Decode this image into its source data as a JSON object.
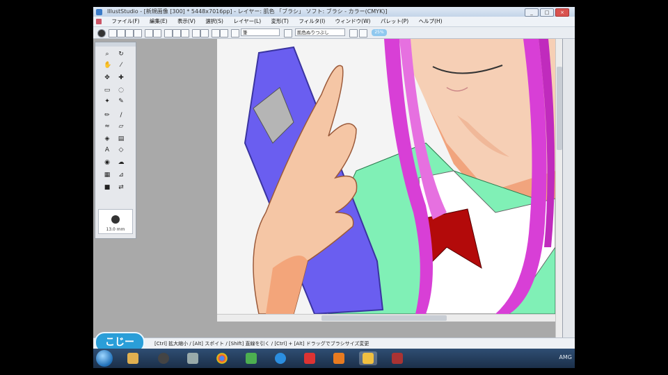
{
  "app": {
    "title": "IllustStudio - [新規画像 [300] * 5448x7016pp] - レイヤー: 肌色 「ブラシ」 ソフト: ブラシ - カラー(CMYK)]",
    "window_buttons": [
      "_",
      "□",
      "×"
    ]
  },
  "menu": {
    "items": [
      "ファイル(F)",
      "編集(E)",
      "表示(V)",
      "選択(S)",
      "レイヤー(L)",
      "変形(T)",
      "フィルタ(I)",
      "ウィンドウ(W)",
      "パレット(P)",
      "ヘルプ(H)"
    ]
  },
  "toolbar": {
    "brush_select": "筆",
    "layer_select": "肌色ぬりつぶし",
    "zoom_badge": "25%"
  },
  "tools": {
    "icons": [
      "zoom-icon",
      "rotate-icon",
      "hand-icon",
      "eyedropper-icon",
      "move-icon",
      "select-icon",
      "marquee-icon",
      "lasso-icon",
      "wand-icon",
      "pen-icon",
      "pencil-icon",
      "brush-icon",
      "airbrush-icon",
      "eraser-icon",
      "fill-icon",
      "gradient-icon",
      "text-icon",
      "shape-icon",
      "blur-icon",
      "smudge-icon"
    ],
    "brush_size": "13.0 mm"
  },
  "statusbar": {
    "text": "[Ctrl] 拡大縮小 / [Alt] スポイト / [Shift] 直線を引く / [Ctrl] + [Alt] ドラッグでブラシサイズ変更"
  },
  "logo": {
    "text": "こじー"
  },
  "taskbar": {
    "clock": "AMG"
  },
  "colors": {
    "clipboard": "#6a5ef0",
    "hair": "#d83fd6",
    "skin": "#f5c6a5",
    "uniform": "#7df0b2",
    "ribbon": "#b30a0a",
    "canvas_bg": "#f3f3f3"
  }
}
